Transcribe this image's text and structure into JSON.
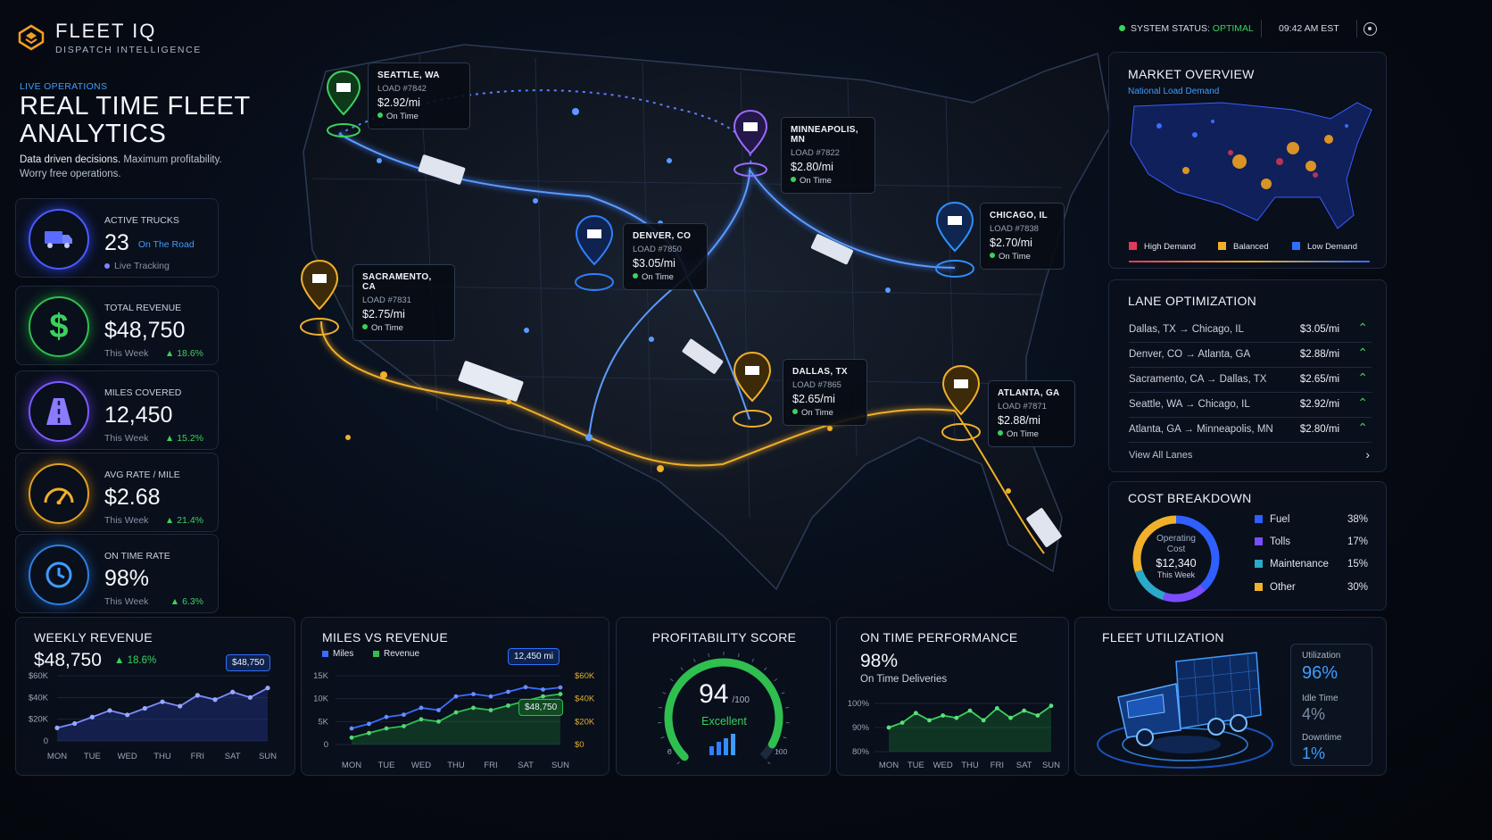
{
  "brand": {
    "name": "FLEET IQ",
    "subtitle": "DISPATCH INTELLIGENCE"
  },
  "header": {
    "status_label": "SYSTEM STATUS:",
    "status_value": "OPTIMAL",
    "time": "09:42 AM EST",
    "status_color": "#3bd15c"
  },
  "hero": {
    "eyebrow": "LIVE OPERATIONS",
    "title_line1": "REAL TIME FLEET",
    "title_line2": "ANALYTICS",
    "subtitle_bold": "Data driven decisions.",
    "subtitle_rest": " Maximum profitability. Worry free operations."
  },
  "kpis": [
    {
      "label": "ACTIVE TRUCKS",
      "value": "23",
      "value_note": "On The Road",
      "footer": "Live Tracking",
      "change": "",
      "icon": "truck-icon",
      "color": "#5a6cff"
    },
    {
      "label": "TOTAL REVENUE",
      "value": "$48,750",
      "footer": "This Week",
      "change": "18.6%",
      "icon": "dollar-icon",
      "color": "#3bd15c"
    },
    {
      "label": "MILES COVERED",
      "value": "12,450",
      "footer": "This Week",
      "change": "15.2%",
      "icon": "road-icon",
      "color": "#8a6bff"
    },
    {
      "label": "AVG RATE / MILE",
      "value": "$2.68",
      "footer": "This Week",
      "change": "21.4%",
      "icon": "gauge-icon",
      "color": "#f0b02a"
    },
    {
      "label": "ON TIME RATE",
      "value": "98%",
      "footer": "This Week",
      "change": "6.3%",
      "icon": "clock-icon",
      "color": "#2f8fff"
    }
  ],
  "map_pins": [
    {
      "city": "SEATTLE, WA",
      "load": "LOAD #7842",
      "rate": "$2.92/mi",
      "status": "On Time",
      "color": "#3bd15c"
    },
    {
      "city": "MINNEAPOLIS, MN",
      "load": "LOAD #7822",
      "rate": "$2.80/mi",
      "status": "On Time",
      "color": "#9b6bff"
    },
    {
      "city": "DENVER, CO",
      "load": "LOAD #7850",
      "rate": "$3.05/mi",
      "status": "On Time",
      "color": "#2f7fff"
    },
    {
      "city": "CHICAGO, IL",
      "load": "LOAD #7838",
      "rate": "$2.70/mi",
      "status": "On Time",
      "color": "#2f8fff"
    },
    {
      "city": "SACRAMENTO, CA",
      "load": "LOAD #7831",
      "rate": "$2.75/mi",
      "status": "On Time",
      "color": "#f0b02a"
    },
    {
      "city": "DALLAS, TX",
      "load": "LOAD #7865",
      "rate": "$2.65/mi",
      "status": "On Time",
      "color": "#f0b02a"
    },
    {
      "city": "ATLANTA, GA",
      "load": "LOAD #7871",
      "rate": "$2.88/mi",
      "status": "On Time",
      "color": "#f0b02a"
    }
  ],
  "market": {
    "title": "MARKET OVERVIEW",
    "subtitle": "National Load Demand",
    "legend": [
      {
        "label": "High Demand",
        "color": "#e0395a"
      },
      {
        "label": "Balanced",
        "color": "#f0b02a"
      },
      {
        "label": "Low Demand",
        "color": "#2f6fff"
      }
    ]
  },
  "lanes": {
    "title": "LANE OPTIMIZATION",
    "rows": [
      {
        "route": "Dallas, TX → Chicago, IL",
        "rate": "$3.05/mi"
      },
      {
        "route": "Denver, CO → Atlanta, GA",
        "rate": "$2.88/mi"
      },
      {
        "route": "Sacramento, CA → Dallas, TX",
        "rate": "$2.65/mi"
      },
      {
        "route": "Seattle, WA → Chicago, IL",
        "rate": "$2.92/mi"
      },
      {
        "route": "Atlanta, GA → Minneapolis, MN",
        "rate": "$2.80/mi"
      }
    ],
    "view_all": "View All Lanes"
  },
  "cost": {
    "title": "COST BREAKDOWN",
    "center_label": "Operating Cost",
    "center_value": "$12,340",
    "center_note": "This Week",
    "items": [
      {
        "label": "Fuel",
        "pct": "38%",
        "value": 38,
        "color": "#2f5fff"
      },
      {
        "label": "Tolls",
        "pct": "17%",
        "value": 17,
        "color": "#7a4dff"
      },
      {
        "label": "Maintenance",
        "pct": "15%",
        "value": 15,
        "color": "#2aa9c9"
      },
      {
        "label": "Other",
        "pct": "30%",
        "value": 30,
        "color": "#f0b02a"
      }
    ]
  },
  "weekly_revenue": {
    "title": "WEEKLY REVENUE",
    "value": "$48,750",
    "change": "18.6%",
    "callout": "$48,750"
  },
  "miles_vs_revenue": {
    "title": "MILES VS REVENUE",
    "legend_miles": "Miles",
    "legend_revenue": "Revenue",
    "callout_miles": "12,450 mi",
    "callout_revenue": "$48,750"
  },
  "profitability": {
    "title": "PROFITABILITY SCORE",
    "score": "94",
    "max": "/100",
    "label": "Excellent",
    "value": 94,
    "tick_min": "0",
    "tick_max": "100"
  },
  "on_time": {
    "title": "ON TIME PERFORMANCE",
    "value": "98%",
    "subtitle": "On Time Deliveries"
  },
  "utilization": {
    "title": "FLEET UTILIZATION",
    "stats": [
      {
        "label": "Utilization",
        "value": "96%"
      },
      {
        "label": "Idle Time",
        "value": "4%"
      },
      {
        "label": "Downtime",
        "value": "1%"
      }
    ]
  },
  "chart_data": [
    {
      "type": "area",
      "title": "WEEKLY REVENUE",
      "categories": [
        "MON",
        "TUE",
        "WED",
        "THU",
        "FRI",
        "SAT",
        "SUN"
      ],
      "x": [
        0,
        0.5,
        1,
        1.5,
        2,
        2.5,
        3,
        3.5,
        4,
        4.5,
        5,
        5.5,
        6
      ],
      "yticks": [
        "0",
        "$20K",
        "$40K",
        "$60K"
      ],
      "ylim": [
        0,
        60000
      ],
      "series": [
        {
          "values": [
            12000,
            16000,
            22000,
            28000,
            24000,
            30000,
            36000,
            32000,
            42000,
            38000,
            45000,
            40000,
            48750
          ]
        }
      ]
    },
    {
      "type": "line",
      "title": "MILES VS REVENUE",
      "categories": [
        "MON",
        "TUE",
        "WED",
        "THU",
        "FRI",
        "SAT",
        "SUN"
      ],
      "x": [
        0,
        0.5,
        1,
        1.5,
        2,
        2.5,
        3,
        3.5,
        4,
        4.5,
        5,
        5.5,
        6
      ],
      "yticks_left": [
        "0",
        "5K",
        "10K",
        "15K"
      ],
      "yticks_right": [
        "$0",
        "$20K",
        "$40K",
        "$60K"
      ],
      "ylim": [
        0,
        15000
      ],
      "series": [
        {
          "name": "Miles",
          "values": [
            3500,
            4500,
            6000,
            6500,
            8000,
            7500,
            10500,
            11000,
            10500,
            11500,
            12500,
            12000,
            12450
          ]
        },
        {
          "name": "Revenue",
          "values": [
            1500,
            2500,
            3500,
            4000,
            5500,
            5000,
            7000,
            8000,
            7500,
            8500,
            9500,
            10500,
            11000
          ]
        }
      ]
    },
    {
      "type": "area",
      "title": "ON TIME PERFORMANCE",
      "categories": [
        "MON",
        "TUE",
        "WED",
        "THU",
        "FRI",
        "SAT",
        "SUN"
      ],
      "x": [
        0,
        0.5,
        1,
        1.5,
        2,
        2.5,
        3,
        3.5,
        4,
        4.5,
        5,
        5.5,
        6
      ],
      "yticks": [
        "80%",
        "90%",
        "100%"
      ],
      "ylim": [
        80,
        100
      ],
      "series": [
        {
          "values": [
            90,
            92,
            96,
            93,
            95,
            94,
            97,
            93,
            98,
            94,
            97,
            95,
            99
          ]
        }
      ]
    }
  ]
}
